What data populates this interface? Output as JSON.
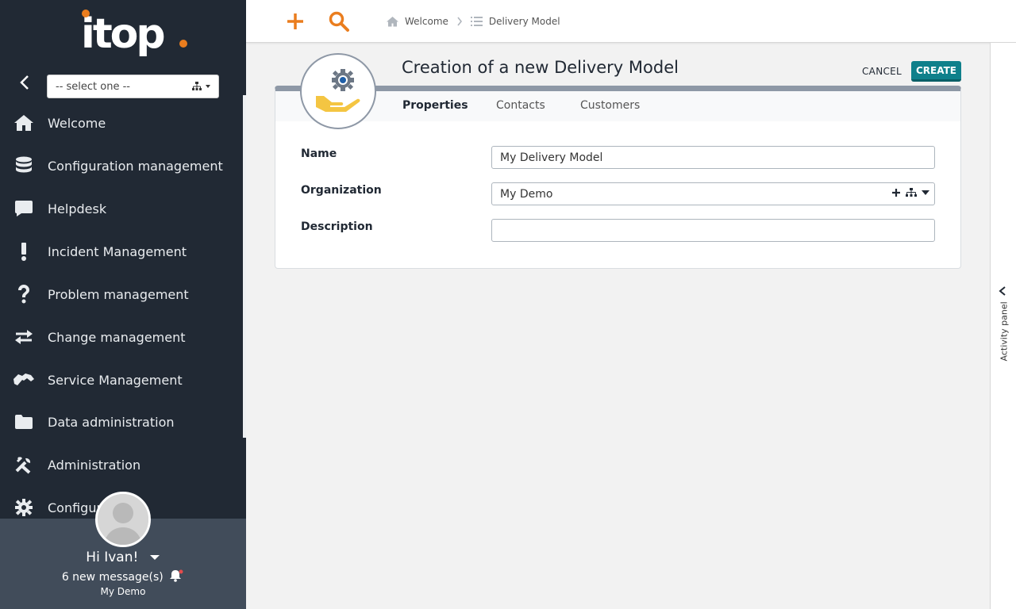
{
  "app": {
    "logo_text": "itop"
  },
  "sidebar": {
    "org_select_placeholder": "-- select one --",
    "items": [
      {
        "label": "Welcome",
        "icon": "home-icon"
      },
      {
        "label": "Configuration management",
        "icon": "database-icon"
      },
      {
        "label": "Helpdesk",
        "icon": "chat-icon"
      },
      {
        "label": "Incident Management",
        "icon": "exclamation-icon"
      },
      {
        "label": "Problem management",
        "icon": "question-icon"
      },
      {
        "label": "Change management",
        "icon": "exchange-icon"
      },
      {
        "label": "Service Management",
        "icon": "handshake-icon"
      },
      {
        "label": "Data administration",
        "icon": "folder-icon"
      },
      {
        "label": "Administration",
        "icon": "tools-icon"
      },
      {
        "label": "Configur",
        "icon": "gear-icon"
      }
    ],
    "user": {
      "greeting": "Hi Ivan!",
      "messages": "6 new message(s)",
      "organization": "My Demo"
    }
  },
  "topbar": {
    "breadcrumb": [
      {
        "label": "Welcome",
        "icon": "home-icon"
      },
      {
        "label": "Delivery Model",
        "icon": "list-icon"
      }
    ]
  },
  "page": {
    "title": "Creation of a new Delivery Model",
    "cancel_label": "CANCEL",
    "create_label": "CREATE",
    "tabs": [
      {
        "label": "Properties",
        "active": true
      },
      {
        "label": "Contacts",
        "active": false
      },
      {
        "label": "Customers",
        "active": false
      }
    ],
    "fields": {
      "name": {
        "label": "Name",
        "value": "My Delivery Model"
      },
      "organization": {
        "label": "Organization",
        "value": "My Demo"
      },
      "description": {
        "label": "Description",
        "value": ""
      }
    }
  },
  "activity_panel": {
    "label": "Activity panel"
  },
  "colors": {
    "sidebar_bg": "#212934",
    "accent_orange": "#ea7d1e",
    "create_button": "#0f808b",
    "user_panel_bg": "#414c5a"
  }
}
